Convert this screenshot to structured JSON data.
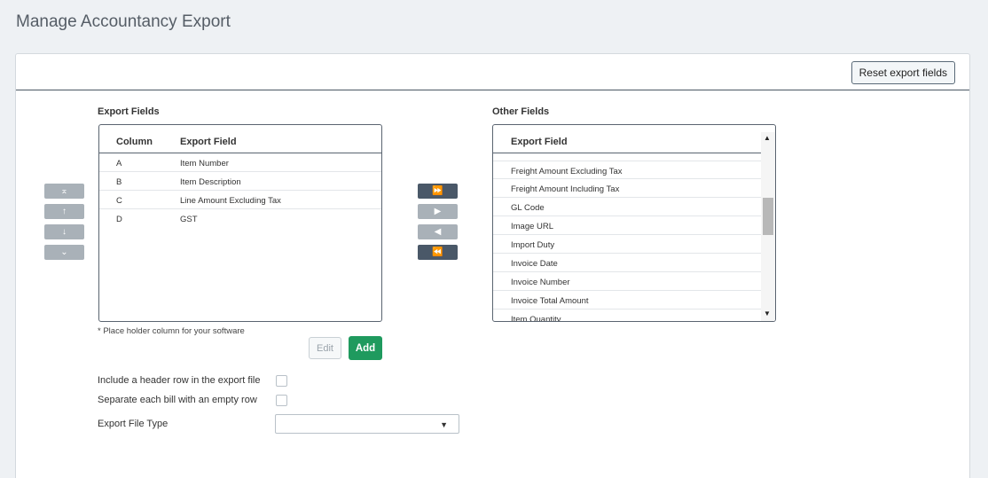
{
  "page": {
    "title": "Manage Accountancy Export"
  },
  "toolbar": {
    "reset_label": "Reset export fields"
  },
  "export_fields": {
    "label": "Export Fields",
    "columns": [
      "Column",
      "Export Field"
    ],
    "rows": [
      {
        "column": "A",
        "field": "Item Number"
      },
      {
        "column": "B",
        "field": "Item Description"
      },
      {
        "column": "C",
        "field": "Line Amount Excluding Tax"
      },
      {
        "column": "D",
        "field": "GST"
      }
    ],
    "note": "* Place holder column for your software",
    "edit_label": "Edit",
    "add_label": "Add"
  },
  "order_controls": [
    "move-top-icon",
    "move-up-icon",
    "move-down-icon",
    "move-bottom-icon"
  ],
  "transfer_controls": [
    "add-all-icon",
    "add-selected-icon",
    "remove-selected-icon",
    "remove-all-icon"
  ],
  "other_fields": {
    "label": "Other Fields",
    "column": "Export Field",
    "items": [
      "Freight Amount Excluding Tax",
      "Freight Amount Including Tax",
      "GL Code",
      "Image URL",
      "Import Duty",
      "Invoice Date",
      "Invoice Number",
      "Invoice Total Amount",
      "Item Quantity"
    ]
  },
  "options": {
    "header_row_label": "Include a header row in the export file",
    "separate_bill_label": "Separate each bill with an empty row",
    "file_type_label": "Export File Type",
    "file_type_value": ""
  },
  "colors": {
    "accent_green": "#1f9a5e",
    "dark_button": "#4a5868",
    "light_button": "#a9b1b8"
  }
}
